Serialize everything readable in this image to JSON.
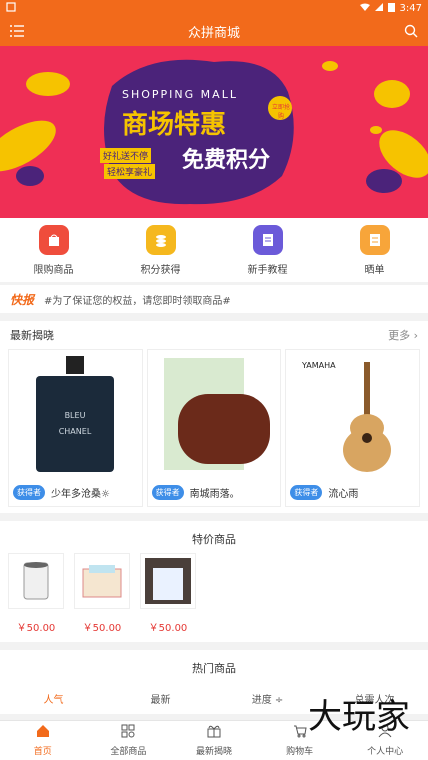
{
  "status": {
    "time": "3:47"
  },
  "header": {
    "title": "众拼商城"
  },
  "banner": {
    "en_title": "SHOPPING MALL",
    "main_title": "商场特惠",
    "sub_title": "免费积分",
    "tag_left_1": "好礼送不停",
    "tag_left_2": "轻松享豪礼",
    "badge": "立即抢购",
    "colors": {
      "bg": "#ef2f55",
      "panel": "#4b237a",
      "gold": "#f6c300"
    }
  },
  "quick_links": [
    {
      "label": "限购商品",
      "icon": "bag-icon",
      "color": "#ef4d3c"
    },
    {
      "label": "积分获得",
      "icon": "coins-icon",
      "color": "#f5b81e"
    },
    {
      "label": "新手教程",
      "icon": "book-icon",
      "color": "#6b5ad9"
    },
    {
      "label": "晒单",
      "icon": "list-icon",
      "color": "#f7a53a"
    }
  ],
  "news": {
    "tag": "快报",
    "text": "#为了保证您的权益，请您即时领取商品#"
  },
  "latest": {
    "title": "最新揭晓",
    "more": "更多",
    "items": [
      {
        "winner_badge": "获得者",
        "winner": "少年多沧桑☼"
      },
      {
        "winner_badge": "获得者",
        "winner": "南城雨落。"
      },
      {
        "winner_badge": "获得者",
        "winner": "流心雨"
      }
    ]
  },
  "special": {
    "title": "特价商品",
    "items": [
      {
        "price": "￥50.00"
      },
      {
        "price": "￥50.00"
      },
      {
        "price": "￥50.00"
      }
    ]
  },
  "hot": {
    "title": "热门商品",
    "tabs": [
      "人气",
      "最新",
      "进度 ÷",
      "总需人次"
    ]
  },
  "bottom_nav": [
    {
      "label": "首页",
      "icon": "home-icon",
      "active": true
    },
    {
      "label": "全部商品",
      "icon": "grid-icon"
    },
    {
      "label": "最新揭晓",
      "icon": "gift-icon"
    },
    {
      "label": "购物车",
      "icon": "cart-icon"
    },
    {
      "label": "个人中心",
      "icon": "person-icon"
    }
  ],
  "watermark": "大玩家",
  "brand": {
    "accent": "#f26a1b"
  }
}
